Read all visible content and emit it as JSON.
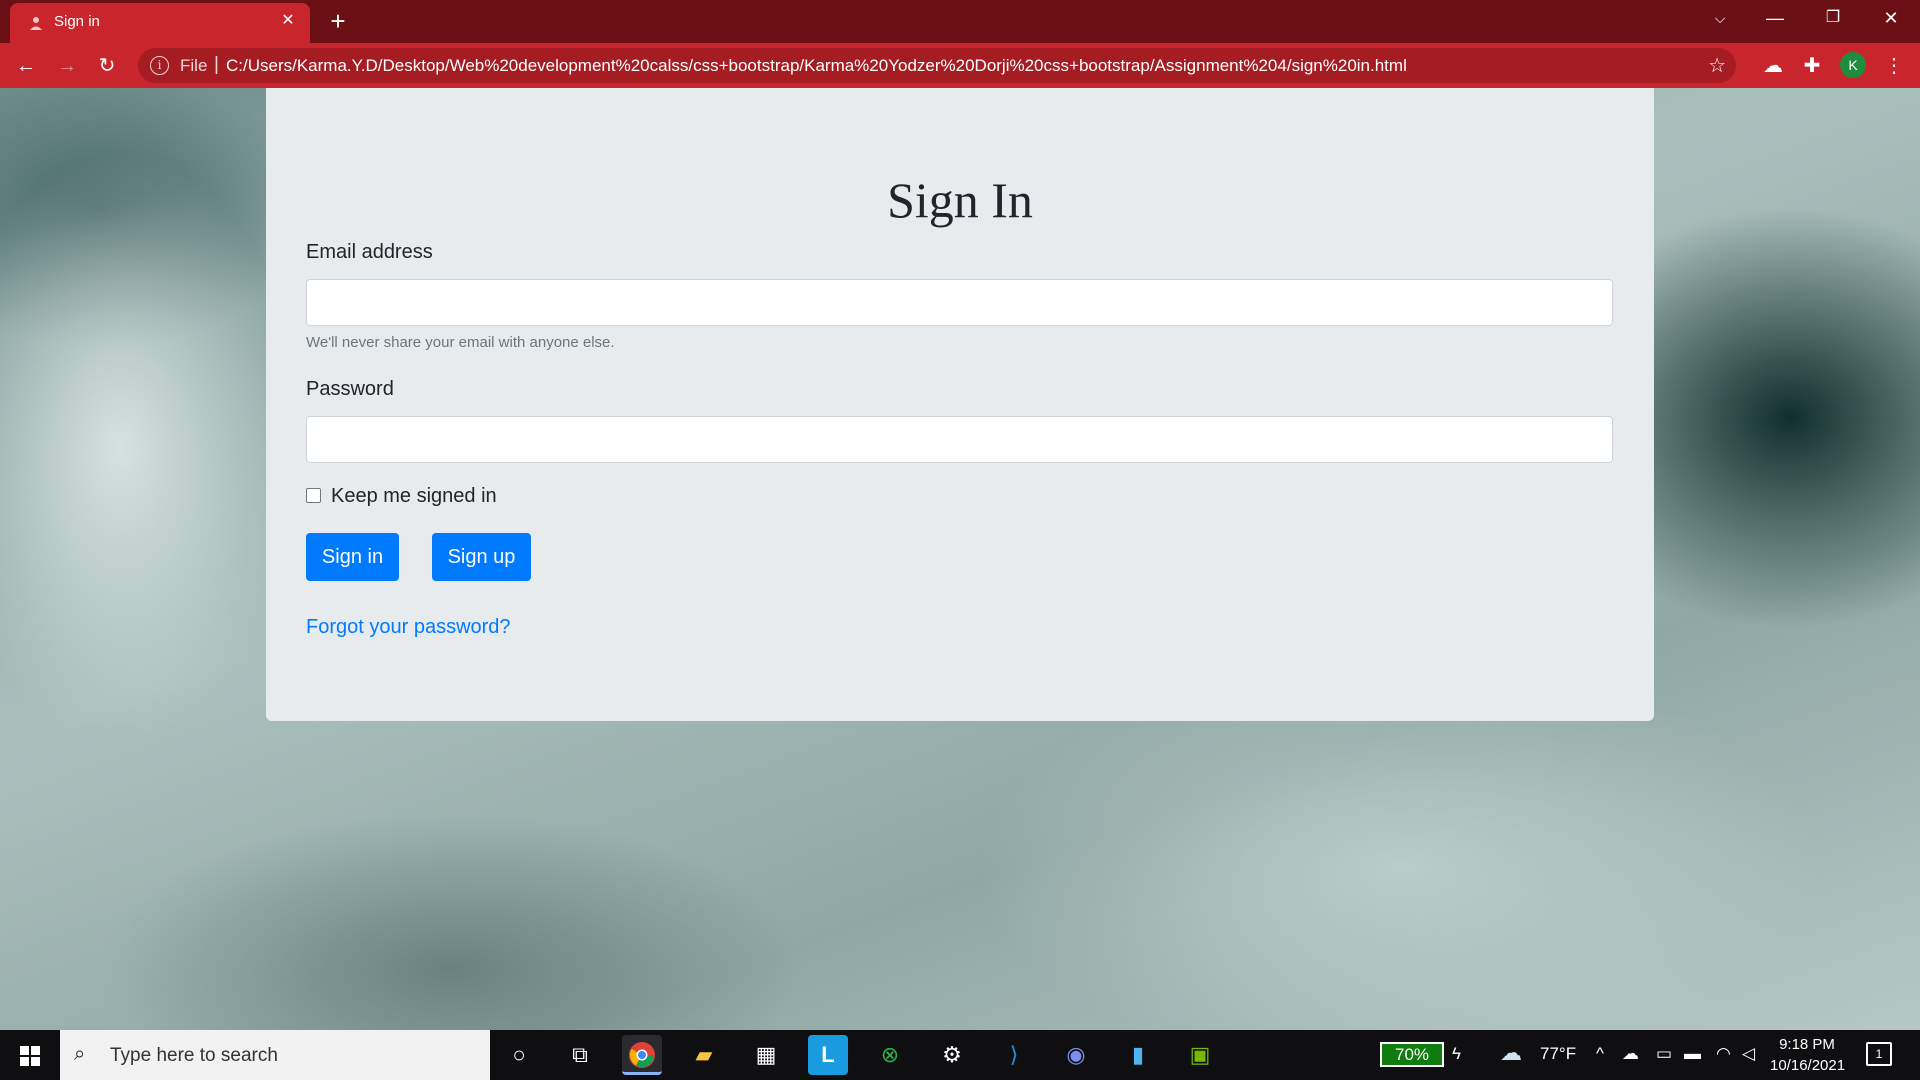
{
  "browser": {
    "tab": {
      "title": "Sign in"
    },
    "address_bar": {
      "scheme_label": "File",
      "url": "C:/Users/Karma.Y.D/Desktop/Web%20development%20calss/css+bootstrap/Karma%20Yodzer%20Dorji%20css+bootstrap/Assignment%204/sign%20in.html"
    },
    "profile_initial": "K",
    "theme_color": "#c8262c"
  },
  "form": {
    "title": "Sign In",
    "email_label": "Email address",
    "email_value": "",
    "email_help": "We'll never share your email with anyone else.",
    "password_label": "Password",
    "password_value": "",
    "keep_signed_in_label": "Keep me signed in",
    "keep_signed_in_checked": false,
    "sign_in_button": "Sign in",
    "sign_up_button": "Sign up",
    "forgot_password_link": "Forgot your password?",
    "button_color": "#007bff"
  },
  "taskbar": {
    "search_placeholder": "Type here to search",
    "battery": "70%",
    "temperature": "77°F",
    "time": "9:18 PM",
    "date": "10/16/2021",
    "notification_count": "1",
    "apps": [
      "cortana",
      "task-view",
      "chrome",
      "file-explorer",
      "microsoft-store",
      "lightshot",
      "xbox",
      "steam",
      "vscode",
      "discord",
      "notepad",
      "nvidia"
    ]
  }
}
